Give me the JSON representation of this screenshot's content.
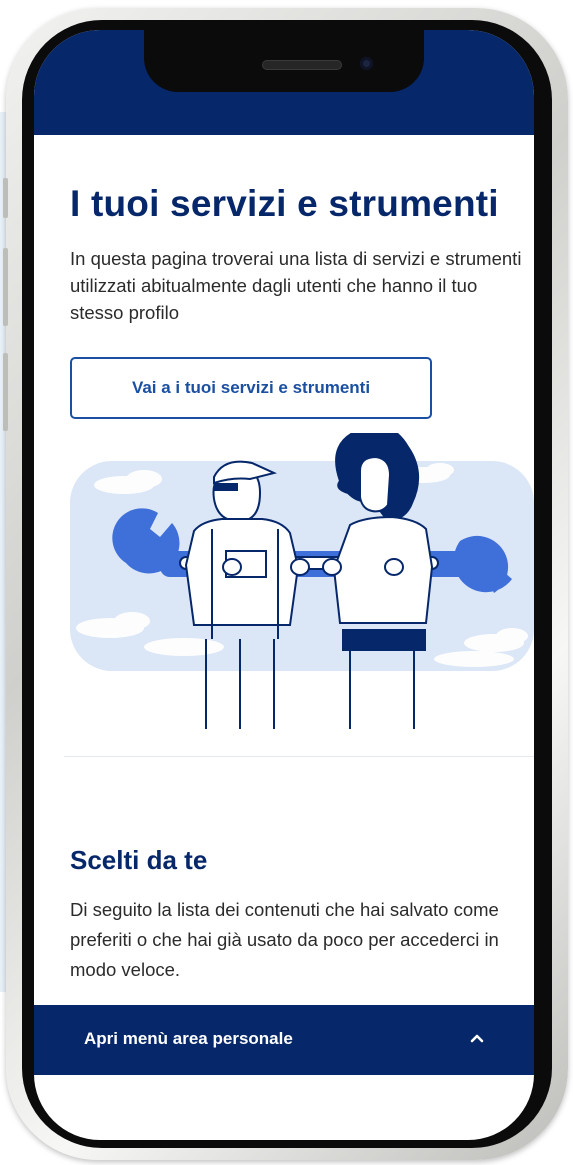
{
  "page": {
    "title": "I tuoi servizi e strumenti",
    "intro": "In questa pagina troverai una lista di servizi e strumenti utilizzati abitualmente dagli utenti che hanno il tuo stesso profilo",
    "cta_label": "Vai a i tuoi servizi e strumenti"
  },
  "saved": {
    "title": "Scelti da te",
    "text": "Di seguito la lista dei contenuti che hai salvato come preferiti o che hai già usato da poco per accederci in modo veloce."
  },
  "menu": {
    "label": "Apri menù area personale",
    "icon": "chevron-up-icon"
  },
  "colors": {
    "brand_dark": "#06276a",
    "brand_blue": "#1b4fa1",
    "illustration_bg": "#dbe6f6",
    "illustration_accent": "#3f6fd8"
  }
}
